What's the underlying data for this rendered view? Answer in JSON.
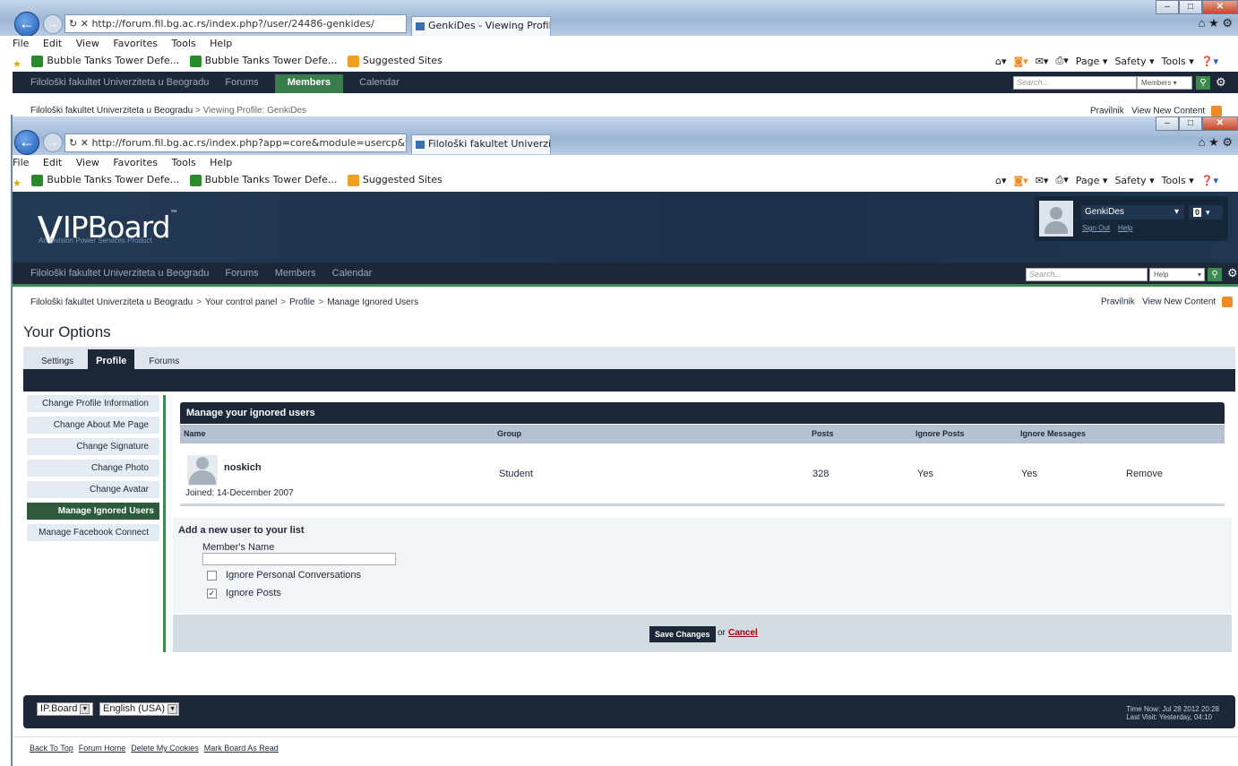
{
  "back_window": {
    "address": "http://forum.fil.bg.ac.rs/index.php?/user/24486-genkides/",
    "tab_title": "GenkiDes - Viewing Profile ...",
    "menu": [
      "File",
      "Edit",
      "View",
      "Favorites",
      "Tools",
      "Help"
    ],
    "favorites": [
      "Bubble Tanks Tower Defe...",
      "Bubble Tanks Tower Defe...",
      "Suggested Sites"
    ],
    "commands": [
      "Page ▾",
      "Safety ▾",
      "Tools ▾"
    ],
    "nav": {
      "site": "Filološki fakultet Univerziteta u Beogradu",
      "forums": "Forums",
      "members": "Members",
      "calendar": "Calendar"
    },
    "search_placeholder": "Search...",
    "search_scope": "Members",
    "crumb_site": "Filološki fakultet Univerziteta u Beogradu",
    "crumb_page": "> Viewing Profile: GenkiDes",
    "link_rules": "Pravilnik",
    "link_new": "View New Content"
  },
  "front_window": {
    "address": "http://forum.fil.bg.ac.rs/index.php?app=core&module=usercp&t:",
    "tab_title": "Filološki fakultet Univerzitet...",
    "menu": [
      "File",
      "Edit",
      "View",
      "Favorites",
      "Tools",
      "Help"
    ],
    "favorites": [
      "Bubble Tanks Tower Defe...",
      "Bubble Tanks Tower Defe...",
      "Suggested Sites"
    ],
    "commands": [
      "Page ▾",
      "Safety ▾",
      "Tools ▾"
    ]
  },
  "header": {
    "logo": "IPBoard",
    "logo_tm": "™",
    "logo_sub": "An Invision Power Services Product",
    "username": "GenkiDes",
    "notif_count": "0",
    "sign_out": "Sign Out",
    "help": "Help"
  },
  "nav": {
    "site": "Filološki fakultet Univerziteta u Beogradu",
    "forums": "Forums",
    "members": "Members",
    "calendar": "Calendar"
  },
  "search": {
    "placeholder": "Search...",
    "scope": "Help"
  },
  "breadcrumb": [
    "Filološki fakultet Univerziteta u Beogradu",
    "Your control panel",
    "Profile",
    "Manage Ignored Users"
  ],
  "toplinks": {
    "rules": "Pravilnik",
    "new_content": "View New Content"
  },
  "page_title": "Your Options",
  "tabs": [
    "Settings",
    "Profile",
    "Forums"
  ],
  "sidebar": [
    "Change Profile Information",
    "Change About Me Page",
    "Change Signature",
    "Change Photo",
    "Change Avatar",
    "Manage Ignored Users",
    "Manage Facebook Connect"
  ],
  "table": {
    "title": "Manage your ignored users",
    "columns": [
      "Name",
      "Group",
      "Posts",
      "Ignore Posts",
      "Ignore Messages"
    ],
    "row": {
      "name": "noskich",
      "joined": "Joined: 14-December 2007",
      "group": "Student",
      "posts": "328",
      "ignore_posts": "Yes",
      "ignore_messages": "Yes",
      "action": "Remove"
    }
  },
  "add_form": {
    "heading": "Add a new user to your list",
    "member_label": "Member's Name",
    "member_value": "",
    "opt_pc": "Ignore Personal Conversations",
    "opt_pc_checked": false,
    "opt_posts": "Ignore Posts",
    "opt_posts_checked": true,
    "save": "Save Changes",
    "or": "or",
    "cancel": "Cancel"
  },
  "footer": {
    "skin": "IP.Board",
    "language": "English (USA)",
    "time_now": "Time Now: Jul 28 2012 20:28",
    "last_visit": "Last Visit: Yesterday, 04:10",
    "links": [
      "Back To Top",
      "Forum Home",
      "Delete My Cookies",
      "Mark Board As Read"
    ]
  },
  "colors": {
    "dark": "#1c2837",
    "green": "#3d8a51",
    "light": "#dee5ed"
  }
}
